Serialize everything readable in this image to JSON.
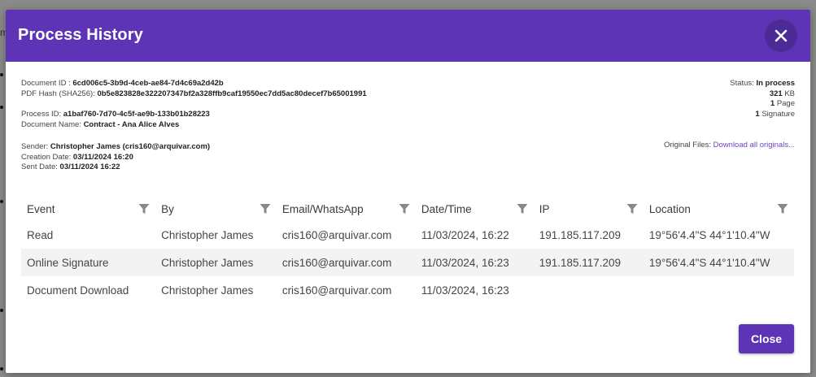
{
  "modal": {
    "title": "Process History",
    "close_label": "Close"
  },
  "document": {
    "id_label": "Document ID :",
    "id": "6cd006c5-3b9d-4ceb-ae84-7d4c69a2d42b",
    "hash_label": "PDF Hash (SHA256):",
    "hash": "0b5e823828e322207347bf2a328ffb9caf19550ec7dd5ac80decef7b65001991",
    "process_label": "Process ID:",
    "process_id": "a1baf760-7d70-4c5f-ae9b-133b01b28223",
    "name_label": "Document Name:",
    "name": "Contract - Ana Alice Alves",
    "sender_label": "Sender:",
    "sender": "Christopher James (cris160@arquivar.com)",
    "creation_label": "Creation Date:",
    "creation_date": "03/11/2024 16:20",
    "sent_label": "Sent Date:",
    "sent_date": "03/11/2024 16:22"
  },
  "summary": {
    "status_label": "Status:",
    "status": "In process",
    "size_value": "321",
    "size_unit": "KB",
    "pages_value": "1",
    "pages_unit": "Page",
    "signatures_value": "1",
    "signatures_unit": "Signature",
    "original_files_label": "Original Files:",
    "download_link": "Download all originals..."
  },
  "table": {
    "columns": [
      "Event",
      "By",
      "Email/WhatsApp",
      "Date/Time",
      "IP",
      "Location"
    ],
    "rows": [
      [
        "Read",
        "Christopher James",
        "cris160@arquivar.com",
        "11/03/2024, 16:22",
        "191.185.117.209",
        "19°56'4.4\"S 44°1'10.4\"W"
      ],
      [
        "Online Signature",
        "Christopher James",
        "cris160@arquivar.com",
        "11/03/2024, 16:23",
        "191.185.117.209",
        "19°56'4.4\"S 44°1'10.4\"W"
      ],
      [
        "Document Download",
        "Christopher James",
        "cris160@arquivar.com",
        "11/03/2024, 16:23",
        "",
        ""
      ]
    ]
  },
  "colors": {
    "header": "#5d34b5",
    "close_circle": "#4c2a97",
    "link": "#6a44c4"
  }
}
